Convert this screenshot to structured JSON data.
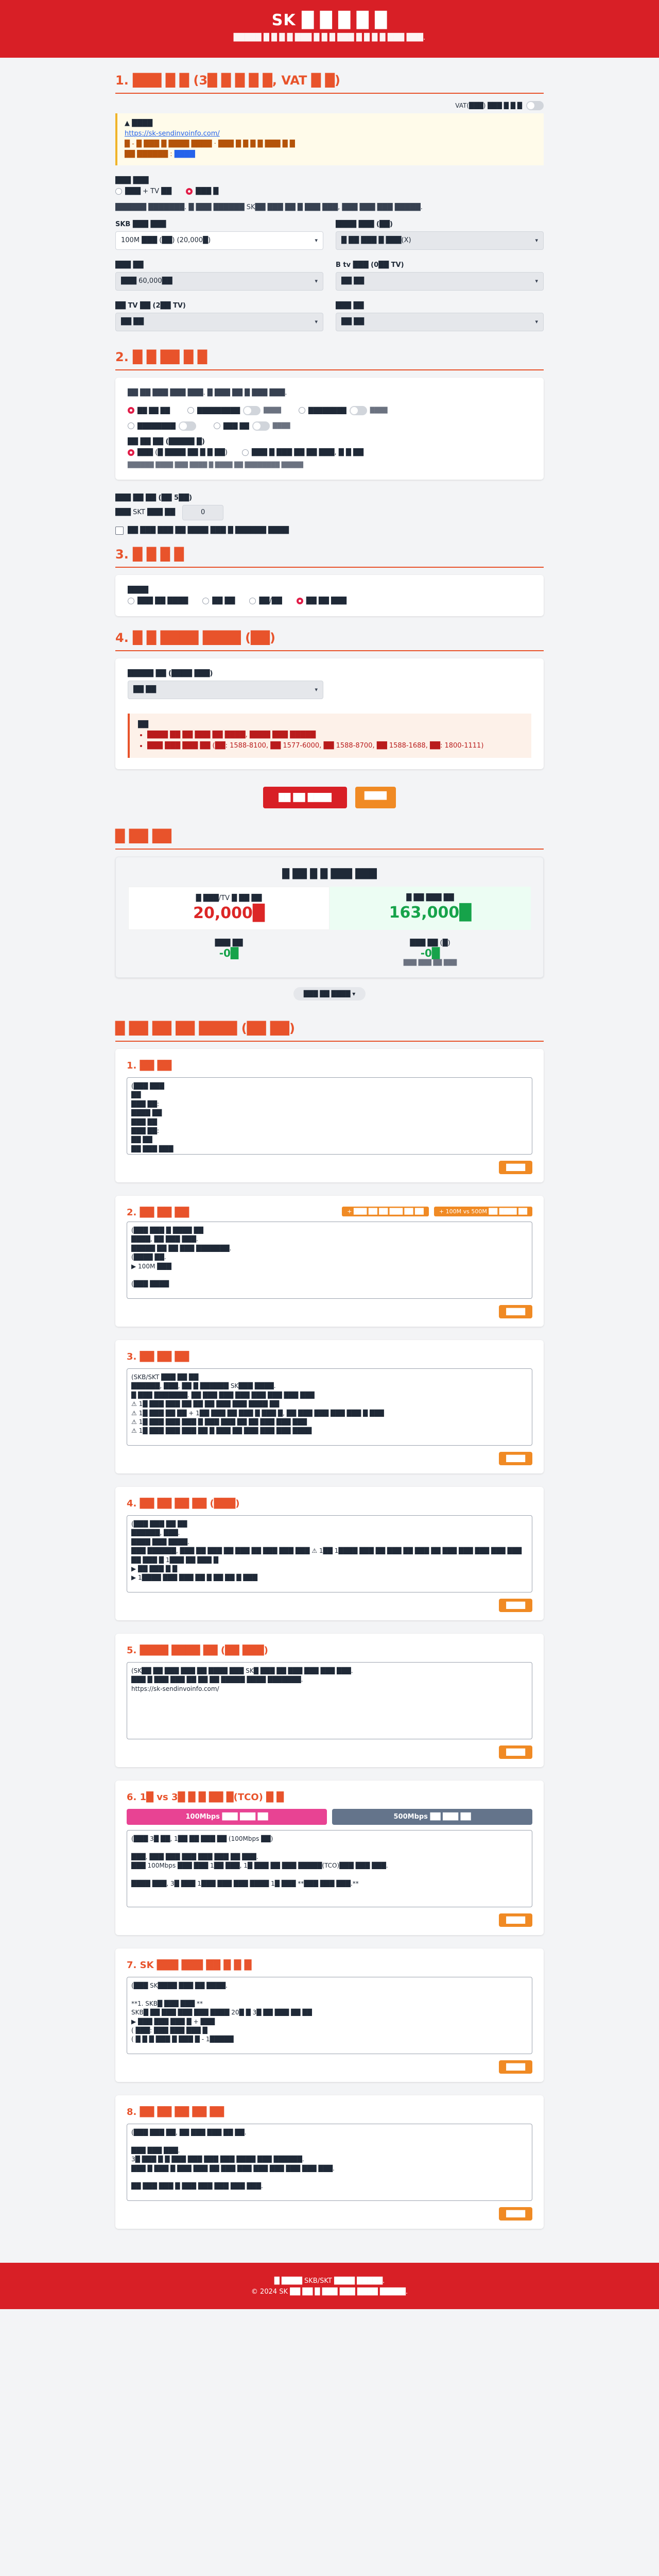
{
  "header": {
    "title": "SK █ █ █ █ █",
    "subtitle": "█████ █ █ █ █ ███ █ █ █ ███ █ █ █ █ ███ ███."
  },
  "s1": {
    "title": "1. ███ █ █ (3█ █ █ █ █, VAT █ █)",
    "vat_label": "VAT(███) ███ █ █ █",
    "notice_head": "▲ ████",
    "notice_link": "https://sk-sendinvoinfo.com/",
    "notice_l2": "█ - █ ███ █ ████ ████ · ███ █ █ █ █ ███ █ █",
    "notice_l3_a": "██ ██████ :",
    "notice_l3_b": "████",
    "q1": "███ ███",
    "r1a": "███ + TV ██",
    "r1b": "███ █",
    "desc": "██████ ███████. █ ███ ██████ SK██ ███ ██ █ ███ ███, ███ ███ ███ █████.",
    "f1": {
      "label": "SKB ███ ███",
      "value": "100M ███ (██) (20,000█)"
    },
    "f2": {
      "label": "████ ███ (██)",
      "value": "█ ██ ███ █ ███(X)"
    },
    "f3": {
      "label": "███ ██",
      "value": "███ 60,000██"
    },
    "f4": {
      "label": "B tv ███ (0██ TV)",
      "value": "██ ██"
    },
    "f5": {
      "label": "██ TV ██ (2██ TV)",
      "value": "██ ██"
    },
    "f6": {
      "label": "███ ██",
      "value": "██ ██"
    }
  },
  "s2": {
    "title": "2. █ █ ██ █ █",
    "desc": "██ ██ ███ ███ ███. █ ███ ██ █ ███ ███.",
    "o1": "██ ██ ██",
    "o2": "█████████",
    "o3": "████████",
    "o4": "████████",
    "o5": "███ ██",
    "mini": "████",
    "q2": "██ ██ ██ (█████ █)",
    "r2a": "███ (█ ████ ██ █ █ ██)",
    "r2b": "███ █ ███ ██ ██ ███, █ █ ██",
    "note": "██████ ████ ███ ████ █ ████ ██ ████████ █████"
  },
  "s3": {
    "lbl": "███ ██ ██ (██ 5██)",
    "sub": "███ SKT ███ ██",
    "qty": "0",
    "chk": "██ ███ ███ ██ ████ ███ █ ██████ ████",
    "title": "3. █ █ █ █",
    "q": "████",
    "r1": "███ ██ ████",
    "r2": "██ ██",
    "r3": "██/██",
    "r4": "██ ██ ███"
  },
  "s4": {
    "title": "4. █ █ ████ ████ (██)",
    "lbl": "█████ ██ (████ ███)",
    "value": "██ ██",
    "info_head": "██",
    "i1": "████ ██ ██ ███ ██ ████, ████ ███ █████",
    "i2": "███ ███ ███ ██ (██: 1588-8100, ██ 1577-6000, ██ 1588-8700, ██ 1588-1688, ██: 1800-1111)"
  },
  "buttons": {
    "calc": "██ ██ ████",
    "reset": "████"
  },
  "result": {
    "title": "█ ██ ██",
    "panel": "█ ██ █ █ ███ ███",
    "a_cap": "█ ███/TV █ ██ ██",
    "a_val": "20,000█",
    "b_cap": "█ ██ ███ ██",
    "b_val": "163,000█",
    "c1_cap": "███ ██",
    "c1_val": "-0█",
    "c2_cap": "███ ██ (█)",
    "c2_val": "-0█",
    "c2_sub": "███ ███ ██ ███",
    "more": "███ ██ ████ ▾"
  },
  "templates": {
    "title": "█ ██ ██ ██ ████ (██ ██)",
    "copy": "████",
    "pill1": "+ ███ ██ ██ ███ ██ ██",
    "pill2": "+ 100M vs 500M ██ ████ ██",
    "tab1": "100Mbps ███ ███ ██",
    "tab2": "500Mbps ██ ███ ██",
    "items": [
      {
        "title": "1. ██ ██",
        "body": "(███ ███\n██\n███ ██:\n████ ██\n███ ██\n███ ██:\n██ ██\n██ ███ ███"
      },
      {
        "title": "2. ██ ██ ██",
        "body": "(███ ███ █ ████ ██\n████, ██ ███ ███.\n█████ ██ ██ ███ ███████.\n(████ ██.\n▶ 100M ███\n\n(███ ████"
      },
      {
        "title": "3. ██ ██ ██",
        "body": "(SKB/SKT ███ ██ ██\n██████, ███, ██ █ ██████ SK███ ████.\n█ ███ ███████. ██ ███ ███ ███ ███ ███ ███ ███\n⚠ 1█ ███ ███ ██ ██ ██ ███ ███ ████ ██\n⚠ 1█ ███ ██ ██ + 1██ ███ ██ ███ █ ███ █, ██ ███ ███ ███ ███ █ ███\n⚠ 1█ ███ ███ ███ █ ███ ███ ██ ██ ███ ███ ███\n⚠ 1█ ███ ███ ███ ██ █ ███ ██ ███ ███ ███ ████"
      },
      {
        "title": "4. ██ ██ ██ ██ (███)",
        "body": "(███ ███ ██ ██\n██████, ███.\n████ ███ ████.\n███ ██████, ███ ██ ███ ██ ███ ██ ███ ███ ███ ⚠ 1██ 1████ ███ ██ ███ ██ ███ ██ ███ ███ ███ ███ ███\n██ ███ █ 1███ ██ ███ █\n▶ ██ ███ █ █\n▶ 1████ ███ ███ ██ █ ██ ██ █ ███"
      },
      {
        "title": "5. ████ ████ ██ (██ ███)",
        "body": "(SK██ ██ ███ ███ ██ ████ ███ SK█ ███ ██ ███ ███ ███ ███.\n███ █ ███ ███ ██ ██ ██ █████ ████ ███████.\nhttps://sk-sendinvoinfo.com/"
      },
      {
        "title": "6. 1█ vs 3█ █ █ ██ █(TCO) █ █",
        "body": "(███ 3█ ██, 1██ ██ ███ ██ (100Mbps ██)\n\n███, ███ ███ ███ ███ ███ ██ ███.\n███ 100Mbps ███ ███ 1██ ███, 1█ ███ ██ ███ █████(TCO)███ ███ ███.\n\n████ ███, 3█ ███ 1███ ███ ███ ████ 1█ ███ **███ ███ ███.**"
      },
      {
        "title": "7. SK ███ ███ ██ █ █ █",
        "body": "(███ SK████ ███ ██ ████.\n\n**1. SKB█ ███ ███ **\nSKB█ ██ ███ ███ ███ ████ 20█ █ 3█ ██ ███ ██ ██\n▶ ███ ███ ███ █ + ███\n( ███: ███ ███ ███ █\n( █ █ █ ███ █ ███ █ - 1█████"
      },
      {
        "title": "8. ██ ██ ██ ██ ██",
        "body": "(███ ███ ██, ██ ███ ███ ██ ██.\n\n███ ███ ███.\n3█ ███ █ █ ███ ███ ███ ███ ████ ███ ██████.\n███ █ ███ █ ███ ███ ██ ███ ███ ███ ███ ███ ███ ███.\n\n██ ███ ███ █ ███ ███ ███ ███ ███."
      }
    ]
  },
  "footer": {
    "l1": "█ ████ SKB/SKT ████ █████.",
    "l2": "© 2024 SK ██ ██ █ ███ ███ ████ █████."
  },
  "colors": {
    "brand": "#d81f26",
    "accent": "#e8532b",
    "button": "#f08a24",
    "pink": "#e84393",
    "slate": "#64748b"
  }
}
